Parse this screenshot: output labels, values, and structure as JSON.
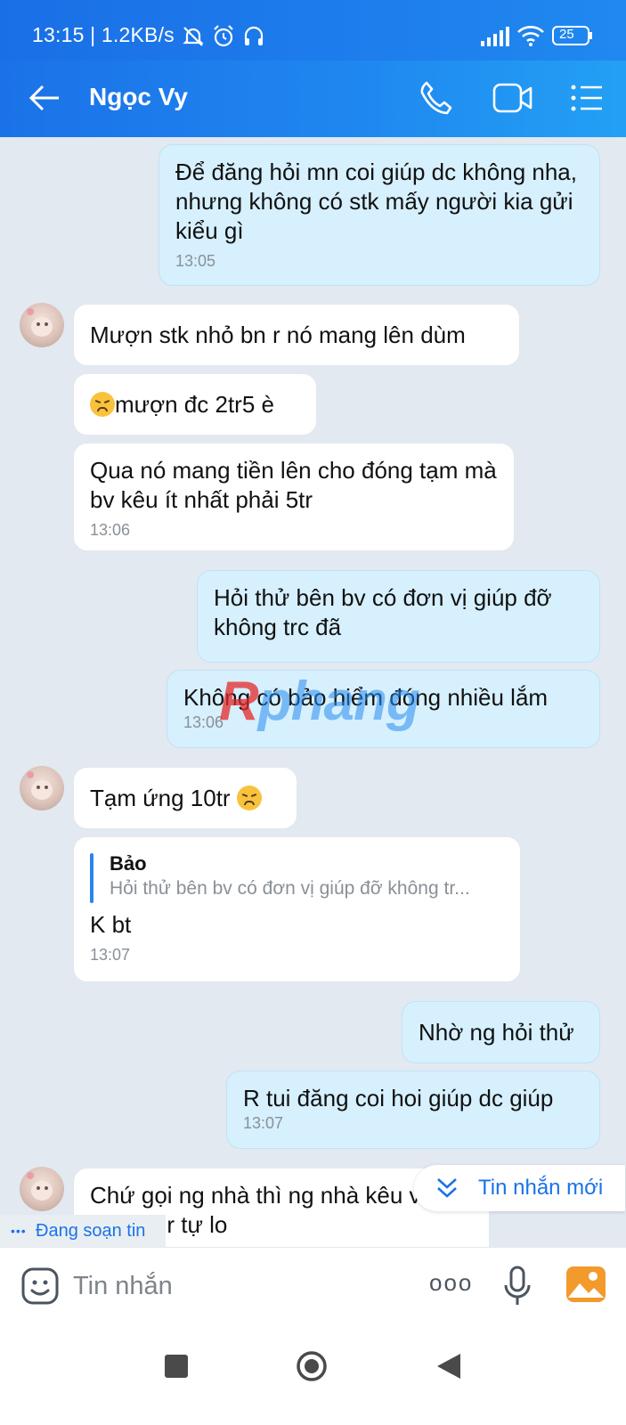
{
  "status_bar": {
    "time_speed": "13:15 | 1.2KB/s",
    "battery": "25"
  },
  "header": {
    "contact_name": "Ngọc Vy"
  },
  "messages": [
    {
      "text": "Để đăng hỏi mn coi giúp dc không nha, nhưng không có stk mấy người kia gửi kiểu gì",
      "time": "13:05"
    },
    {
      "text": "Mượn stk nhỏ bn r nó mang lên dùm"
    },
    {
      "text": "mượn đc 2tr5 è"
    },
    {
      "text": "Qua nó mang tiền lên cho đóng tạm mà bv kêu ít nhất phải 5tr",
      "time": "13:06"
    },
    {
      "text": "Hỏi thử bên bv có đơn vị giúp đỡ không trc đã"
    },
    {
      "text": "Không có bảo hiểm đóng nhiều lắm",
      "time": "13:06"
    },
    {
      "text": "Tạm ứng 10tr"
    },
    {
      "quote_name": "Bảo",
      "quote_text": "Hỏi thử bên bv có đơn vị giúp đỡ không tr...",
      "text": "K bt",
      "time": "13:07"
    },
    {
      "text": "Nhờ ng hỏi thử"
    },
    {
      "text": "R tui đăng coi hoi giúp dc giúp",
      "time": "13:07"
    },
    {
      "text": "Chứ gọi ng nhà thì ng nhà kêu viết giấy tờ r tự lo"
    }
  ],
  "watermark": {
    "part1": "R",
    "part2": "phang"
  },
  "new_message_button": "Tin nhắn mới",
  "typing_indicator": {
    "dots": "•••",
    "label": "Đang soạn tin"
  },
  "composer": {
    "placeholder": "Tin nhắn",
    "more": "ooo"
  },
  "colors": {
    "header": "#1f86ef",
    "outgoing_bubble": "#d6f0fd",
    "incoming_bubble": "#ffffff",
    "background": "#e2e9f1"
  }
}
